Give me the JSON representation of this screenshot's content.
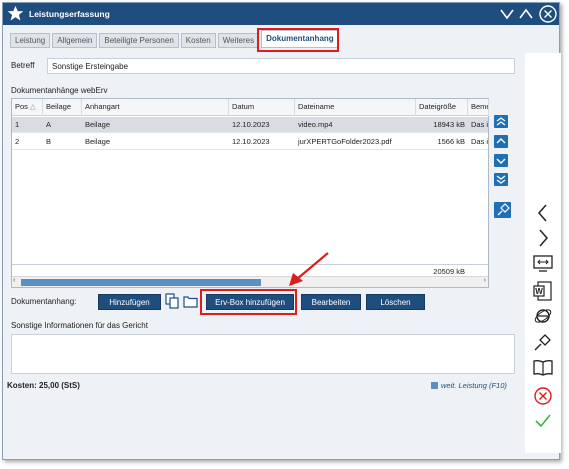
{
  "window": {
    "title": "Leistungserfassung"
  },
  "tabs": [
    {
      "label": "Leistung"
    },
    {
      "label": "Allgemein"
    },
    {
      "label": "Beteiligte Personen"
    },
    {
      "label": "Kosten"
    },
    {
      "label": "Weiteres"
    },
    {
      "label": "Dokumentanhang"
    }
  ],
  "betreff": {
    "label": "Betreff",
    "value": "Sonstige Ersteingabe"
  },
  "attachments": {
    "section_label": "Dokumentanhänge webErv",
    "columns": [
      "Pos",
      "Beilage",
      "Anhangart",
      "Datum",
      "Dateiname",
      "Dateigröße",
      "Beme"
    ],
    "rows": [
      {
        "pos": "1",
        "beilage": "A",
        "anhangart": "Beilage",
        "datum": "12.10.2023",
        "dateiname": "video.mp4",
        "groesse": "18943 kB",
        "beme": "Das i"
      },
      {
        "pos": "2",
        "beilage": "B",
        "anhangart": "Beilage",
        "datum": "12.10.2023",
        "dateiname": "jurXPERTGoFolder2023.pdf",
        "groesse": "1566 kB",
        "beme": "Das i"
      }
    ],
    "total": "20509 kB"
  },
  "actions": {
    "label": "Dokumentanhang:",
    "add": "Hinzufügen",
    "erv_add": "Erv-Box hinzufügen",
    "edit": "Bearbeiten",
    "delete": "Löschen"
  },
  "sonstige": {
    "label": "Sonstige Informationen für das Gericht",
    "value": ""
  },
  "footer": {
    "kosten": "Kosten: 25,00 (StS)",
    "weit": "weit. Leistung (F10)"
  },
  "colors": {
    "titlebar": "#1f4d7d",
    "highlight": "#e01b1b",
    "accent": "#1f6fb5"
  }
}
